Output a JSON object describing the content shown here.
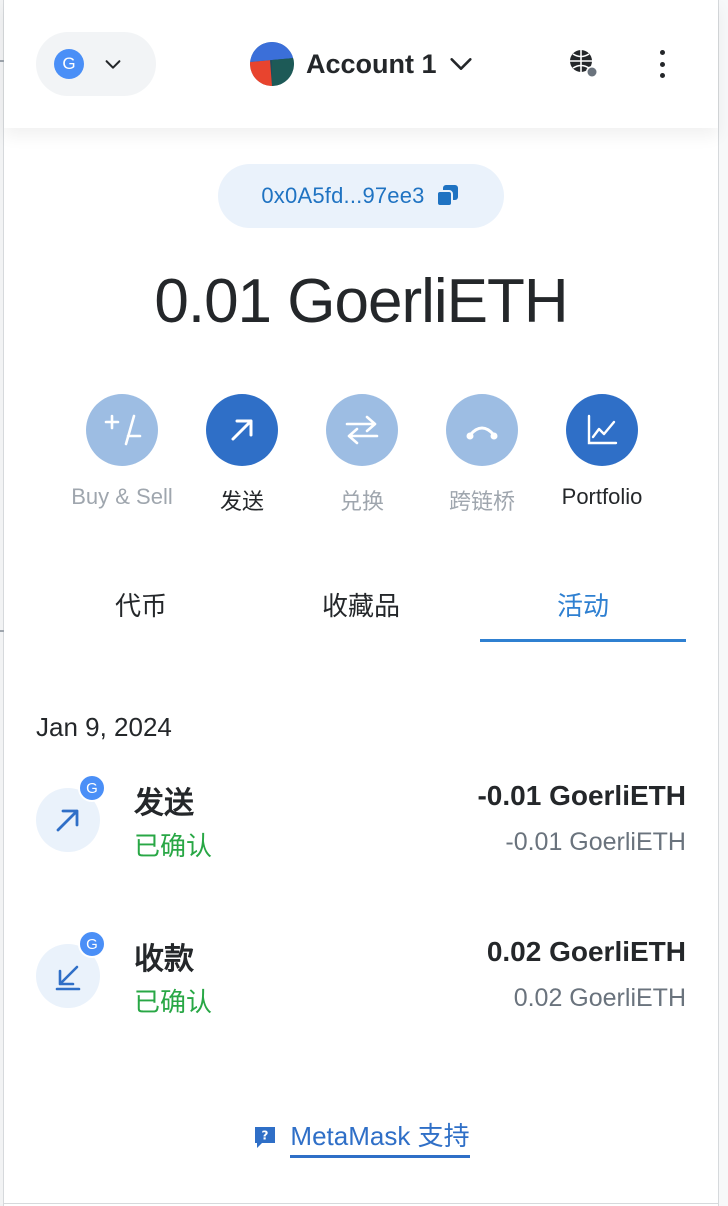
{
  "header": {
    "network_initial": "G",
    "account_name": "Account 1"
  },
  "address": {
    "short": "0x0A5fd...97ee3"
  },
  "balance": {
    "text": "0.01 GoerliETH"
  },
  "actions": [
    {
      "label": "Buy & Sell",
      "icon": "plus-minus-icon",
      "enabled": false
    },
    {
      "label": "发送",
      "icon": "send-arrow-icon",
      "enabled": true
    },
    {
      "label": "兑换",
      "icon": "swap-arrows-icon",
      "enabled": false
    },
    {
      "label": "跨链桥",
      "icon": "bridge-icon",
      "enabled": false
    },
    {
      "label": "Portfolio",
      "icon": "chart-icon",
      "enabled": true
    }
  ],
  "tabs": [
    {
      "label": "代币",
      "active": false
    },
    {
      "label": "收藏品",
      "active": false
    },
    {
      "label": "活动",
      "active": true
    }
  ],
  "activity": {
    "date": "Jan 9, 2024",
    "items": [
      {
        "title": "发送",
        "status": "已确认",
        "amount": "-0.01 GoerliETH",
        "amount_secondary": "-0.01 GoerliETH",
        "badge": "G",
        "icon": "send-arrow-icon"
      },
      {
        "title": "收款",
        "status": "已确认",
        "amount": "0.02 GoerliETH",
        "amount_secondary": "0.02 GoerliETH",
        "badge": "G",
        "icon": "receive-arrow-icon"
      }
    ]
  },
  "support": {
    "label": "MetaMask 支持"
  },
  "colors": {
    "accent": "#2f6fc7",
    "accent_light": "#9dbde3",
    "success": "#28a745"
  }
}
